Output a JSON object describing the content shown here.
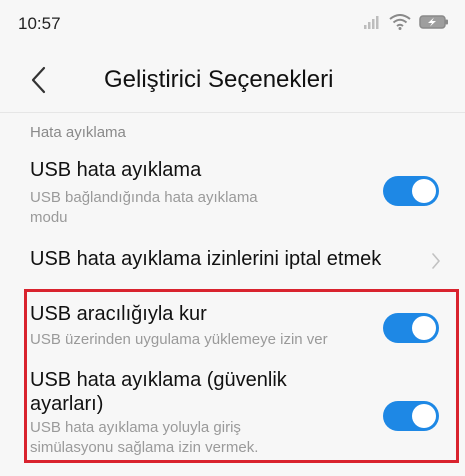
{
  "status_bar": {
    "time": "10:57"
  },
  "header": {
    "title": "Geliştirici Seçenekleri"
  },
  "section": {
    "label": "Hata ayıklama"
  },
  "settings": [
    {
      "title": "USB hata ayıklama",
      "subtitle_line1": "USB bağlandığında hata ayıklama",
      "subtitle_line2": "modu",
      "enabled": true
    },
    {
      "title": "USB hata ayıklama izinlerini iptal etmek"
    },
    {
      "title": "USB aracılığıyla kur",
      "subtitle_line1": "USB üzerinden uygulama yüklemeye izin ver",
      "enabled": true
    },
    {
      "title_line1": "USB hata ayıklama (güvenlik",
      "title_line2": "ayarları)",
      "subtitle_line1": "USB hata ayıklama yoluyla giriş",
      "subtitle_line2": "simülasyonu sağlama izin vermek.",
      "enabled": true
    }
  ],
  "colors": {
    "toggle_on": "#1e88e5",
    "highlight_border": "#d9232e",
    "background": "#f7f7f7"
  },
  "icons": {
    "back": "back-arrow-icon",
    "chevron": "chevron-right-icon",
    "signal": "signal-icon",
    "wifi": "wifi-icon",
    "battery": "battery-charging-icon"
  }
}
